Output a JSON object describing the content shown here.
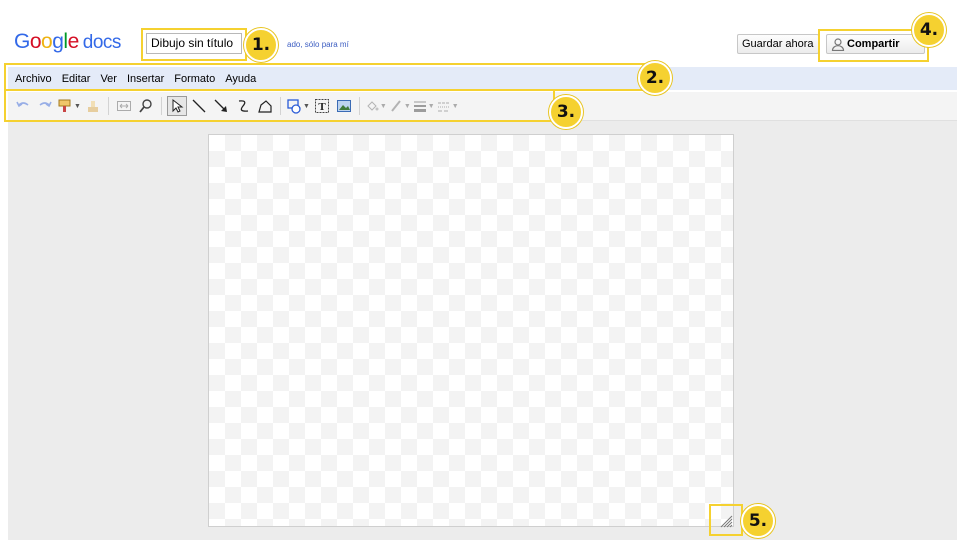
{
  "header": {
    "logo_google": "Google",
    "logo_docs": "docs",
    "doc_title": "Dibujo sin título",
    "save_status": "ado, sólo para mí",
    "save_now_label": "Guardar ahora",
    "share_label": "Compartir"
  },
  "menu": {
    "items": [
      "Archivo",
      "Editar",
      "Ver",
      "Insertar",
      "Formato",
      "Ayuda"
    ]
  },
  "toolbar": {
    "buttons": [
      "undo-icon",
      "redo-icon",
      "paint-format-icon",
      "clear-format-icon",
      "fit-width-icon",
      "zoom-icon",
      "select-icon",
      "line-icon",
      "arrow-icon",
      "curve-icon",
      "polyline-icon",
      "shape-icon",
      "text-box-icon",
      "image-icon",
      "fill-color-icon",
      "line-color-icon",
      "line-weight-icon",
      "line-dash-icon"
    ]
  },
  "callouts": {
    "labels": [
      "1.",
      "2.",
      "3.",
      "4.",
      "5."
    ],
    "color": "#f5d130"
  },
  "colors": {
    "menubar_bg": "#e4ebf8",
    "workspace_bg": "#ececec",
    "google_blue": "#3369e8",
    "google_red": "#d50f25",
    "google_yellow": "#eeb211",
    "google_green": "#009925"
  }
}
